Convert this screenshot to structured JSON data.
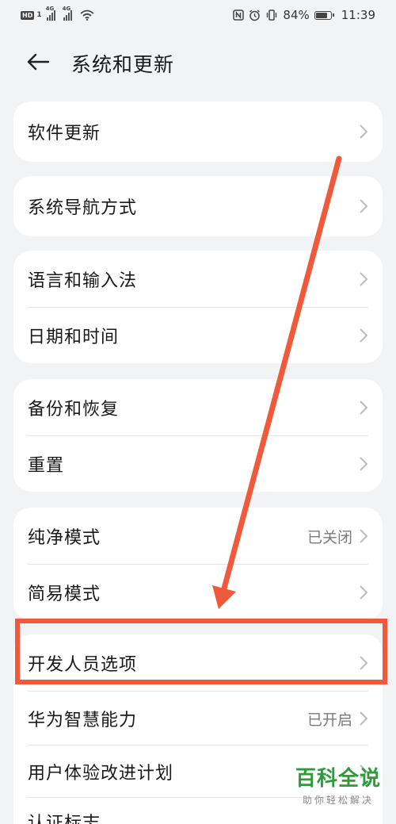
{
  "status_bar": {
    "hd_label": "HD",
    "sim1": "1",
    "net_label": "4G",
    "battery_percent": "84%",
    "battery_level": 0.84,
    "time": "11:39",
    "icons": [
      "nfc-icon",
      "alarm-icon",
      "vibrate-icon",
      "wifi-icon"
    ]
  },
  "header": {
    "title": "系统和更新",
    "back_icon": "arrow-left-icon"
  },
  "cards": [
    {
      "rows": [
        {
          "label": "软件更新",
          "value": ""
        }
      ]
    },
    {
      "rows": [
        {
          "label": "系统导航方式",
          "value": ""
        }
      ]
    },
    {
      "rows": [
        {
          "label": "语言和输入法",
          "value": ""
        },
        {
          "label": "日期和时间",
          "value": ""
        }
      ]
    },
    {
      "rows": [
        {
          "label": "备份和恢复",
          "value": ""
        },
        {
          "label": "重置",
          "value": ""
        }
      ]
    },
    {
      "rows": [
        {
          "label": "纯净模式",
          "value": "已关闭"
        },
        {
          "label": "简易模式",
          "value": ""
        }
      ]
    },
    {
      "rows": [
        {
          "label": "开发人员选项",
          "value": ""
        },
        {
          "label": "华为智慧能力",
          "value": "已开启"
        },
        {
          "label": "用户体验改进计划",
          "value": ""
        },
        {
          "label": "认证标志",
          "value": ""
        }
      ]
    }
  ],
  "annotation": {
    "color": "#f05a3c",
    "highlight_target": "开发人员选项"
  },
  "watermark": {
    "title": "百科全说",
    "subtitle": "助你轻松解决"
  }
}
